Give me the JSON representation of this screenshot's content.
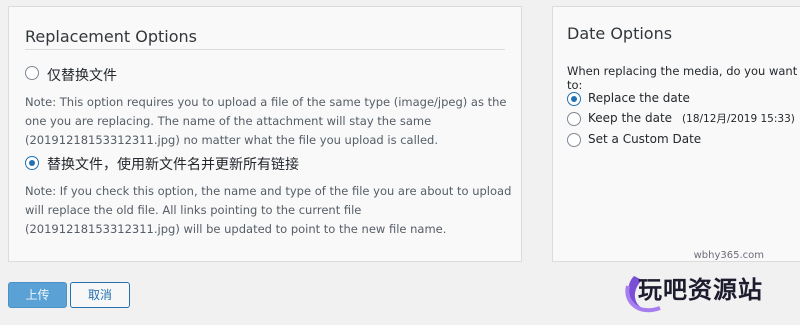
{
  "replacement": {
    "title": "Replacement Options",
    "option1_label": "仅替换文件",
    "option1_note": "Note: This option requires you to upload a file of the same type (image/jpeg) as the one you are replacing. The name of the attachment will stay the same (20191218153312311.jpg) no matter what the file you upload is called.",
    "option2_label": "替换文件，使用新文件名并更新所有链接",
    "option2_note": "Note: If you check this option, the name and type of the file you are about to upload will replace the old file. All links pointing to the current file (20191218153312311.jpg) will be updated to point to the new file name."
  },
  "date": {
    "title": "Date Options",
    "intro": "When replacing the media, do you want to:",
    "opt_replace": "Replace the date",
    "opt_keep": "Keep the date",
    "opt_keep_value": "(18/12月/2019 15:33)",
    "opt_custom": "Set a Custom Date"
  },
  "buttons": {
    "upload": "上传",
    "cancel": "取消"
  },
  "watermark": {
    "site": "wbhy365.com",
    "text": "玩吧资源站"
  },
  "colors": {
    "accent": "#2271b1",
    "upload_button": "#5aa2d6"
  }
}
